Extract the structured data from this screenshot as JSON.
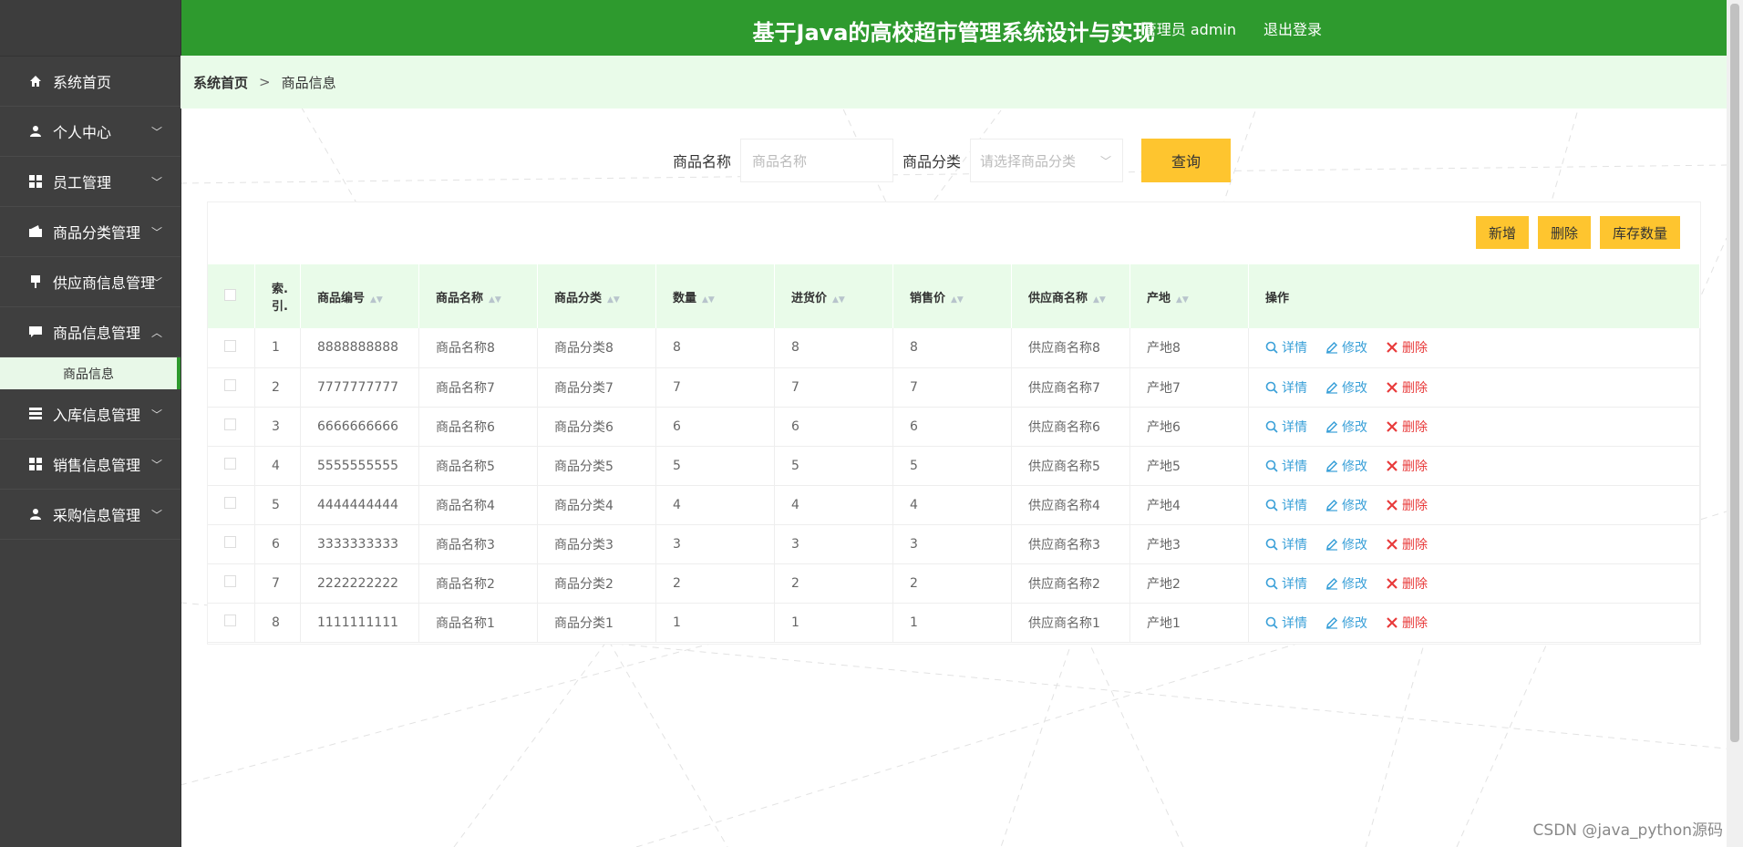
{
  "app": {
    "title": "基于Java的高校超市管理系统设计与实现",
    "admin_label": "管理员 admin",
    "logout_label": "退出登录"
  },
  "sidebar": {
    "items": [
      {
        "label": "系统首页",
        "icon": "home-icon"
      },
      {
        "label": "个人中心",
        "icon": "user-icon",
        "expandable": true
      },
      {
        "label": "员工管理",
        "icon": "grid-icon",
        "expandable": true
      },
      {
        "label": "商品分类管理",
        "icon": "wallet-icon",
        "expandable": true
      },
      {
        "label": "供应商信息管理",
        "icon": "sign-icon",
        "expandable": true
      },
      {
        "label": "商品信息管理",
        "icon": "chat-icon",
        "expandable": true,
        "expanded": true
      },
      {
        "label": "入库信息管理",
        "icon": "stack-icon",
        "expandable": true
      },
      {
        "label": "销售信息管理",
        "icon": "grid-icon",
        "expandable": true
      },
      {
        "label": "采购信息管理",
        "icon": "user-icon",
        "expandable": true
      }
    ],
    "sub_item": "商品信息"
  },
  "breadcrumb": {
    "home": "系统首页",
    "separator": ">",
    "current": "商品信息"
  },
  "search": {
    "name_label": "商品名称",
    "name_placeholder": "商品名称",
    "category_label": "商品分类",
    "category_placeholder": "请选择商品分类",
    "query_label": "查询"
  },
  "actions": {
    "add": "新增",
    "delete": "删除",
    "stock": "库存数量"
  },
  "table": {
    "headers": [
      "索.引.",
      "商品编号",
      "商品名称",
      "商品分类",
      "数量",
      "进货价",
      "销售价",
      "供应商名称",
      "产地",
      "操作"
    ],
    "rows": [
      {
        "idx": "1",
        "code": "8888888888",
        "name": "商品名称8",
        "category": "商品分类8",
        "qty": "8",
        "buy": "8",
        "sell": "8",
        "supplier": "供应商名称8",
        "origin": "产地8"
      },
      {
        "idx": "2",
        "code": "7777777777",
        "name": "商品名称7",
        "category": "商品分类7",
        "qty": "7",
        "buy": "7",
        "sell": "7",
        "supplier": "供应商名称7",
        "origin": "产地7"
      },
      {
        "idx": "3",
        "code": "6666666666",
        "name": "商品名称6",
        "category": "商品分类6",
        "qty": "6",
        "buy": "6",
        "sell": "6",
        "supplier": "供应商名称6",
        "origin": "产地6"
      },
      {
        "idx": "4",
        "code": "5555555555",
        "name": "商品名称5",
        "category": "商品分类5",
        "qty": "5",
        "buy": "5",
        "sell": "5",
        "supplier": "供应商名称5",
        "origin": "产地5"
      },
      {
        "idx": "5",
        "code": "4444444444",
        "name": "商品名称4",
        "category": "商品分类4",
        "qty": "4",
        "buy": "4",
        "sell": "4",
        "supplier": "供应商名称4",
        "origin": "产地4"
      },
      {
        "idx": "6",
        "code": "3333333333",
        "name": "商品名称3",
        "category": "商品分类3",
        "qty": "3",
        "buy": "3",
        "sell": "3",
        "supplier": "供应商名称3",
        "origin": "产地3"
      },
      {
        "idx": "7",
        "code": "2222222222",
        "name": "商品名称2",
        "category": "商品分类2",
        "qty": "2",
        "buy": "2",
        "sell": "2",
        "supplier": "供应商名称2",
        "origin": "产地2"
      },
      {
        "idx": "8",
        "code": "1111111111",
        "name": "商品名称1",
        "category": "商品分类1",
        "qty": "1",
        "buy": "1",
        "sell": "1",
        "supplier": "供应商名称1",
        "origin": "产地1"
      }
    ],
    "op_labels": {
      "detail": "详情",
      "edit": "修改",
      "delete": "删除"
    }
  },
  "watermark": "CSDN @java_python源码",
  "colors": {
    "header_green": "#2e9a2e",
    "breadcrumb_bg": "#e9fbe9",
    "button_yellow": "#fec52f",
    "sidebar_bg": "#3f3f3f",
    "link_blue": "#3aa0d8",
    "danger_red": "#e83a3a"
  }
}
